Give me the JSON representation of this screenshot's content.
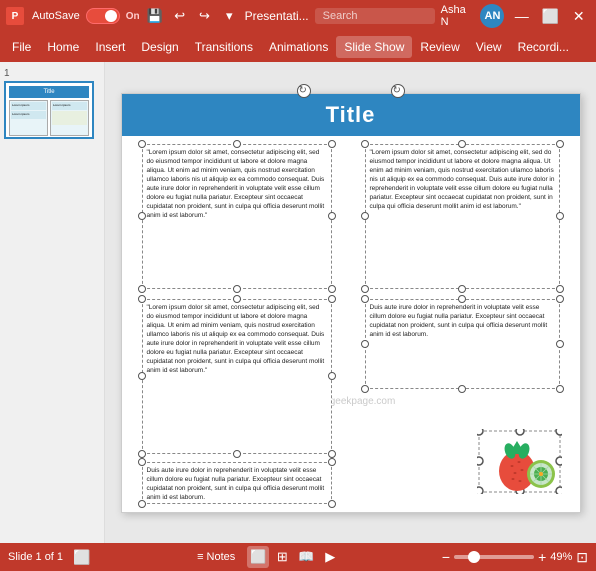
{
  "titleBar": {
    "appName": "P",
    "autosave": "AutoSave",
    "autosaveState": "On",
    "fileName": "Presentati...",
    "searchPlaceholder": "Search",
    "userName": "Asha N",
    "userInitials": "AN"
  },
  "menuBar": {
    "items": [
      "File",
      "Home",
      "Insert",
      "Design",
      "Transitions",
      "Animations",
      "Slide Show",
      "Review",
      "View",
      "Recordi..."
    ]
  },
  "slide": {
    "title": "Title",
    "watermark": "@thegeekpage.com",
    "textBox1": "\"Lorem ipsum dolor sit amet, consectetur adipiscing elit, sed do eiusmod tempor incididunt ut labore et dolore magna aliqua. Ut enim ad minim veniam, quis nostrud exercitation ullamco laboris nis ut aliquip ex ea commodo consequat. Duis aute irure dolor in reprehenderit in voluptate velit esse cillum dolore eu fugiat nulla pariatur. Excepteur sint occaecat cupidatat non proident, sunt in culpa qui officia deserunt mollit anim id est laborum.\"",
    "textBox2": "\"Lorem ipsum dolor sit amet, consectetur adipiscing elit, sed do eiusmod tempor incididunt ut labore et dolore magna aliqua. Ut enim ad minim veniam, quis nostrud exercitation ullamco laboris nis ut aliquip ex ea commodo consequat. Duis aute irure dolor in reprehenderit in voluptate velit esse cillum dolore eu fugiat nulla pariatur. Excepteur sint occaecat cupidatat non proident, sunt in culpa qui officia deserunt mollit anim id est laborum.\"",
    "textBox3": "\"Lorem ipsum dolor sit amet, consectetur adipiscing elit, sed do eiusmod tempor incididunt ut labore et dolore magna aliqua. Ut enim ad minim veniam, quis nostrud exercitation ullamco laboris nis ut aliquip ex ea commodo consequat. Duis aute irure dolor in reprehenderit in voluptate velit esse cillum dolore eu fugiat nulla pariatur. Excepteur sint occaecat cupidatat non proident, sunt in culpa qui officia deserunt mollit anim id est laborum.\"",
    "textBox4": "Duis aute irure dolor in reprehenderit in voluptate velit esse cillum dolore eu fugiat nulla pariatur. Excepteur sint occaecat cupidatat non proident, sunt in culpa qui officia deserunt mollit anim id est laborum.",
    "textBox5": "Duis aute irure dolor in reprehenderit in voluptate velit esse cillum dolore eu fugiat nulla pariatur. Excepteur sint occaecat cupidatat non proident, sunt in culpa qui officia deserunt mollit anim id est laborum."
  },
  "statusBar": {
    "slideCount": "Slide 1 of 1",
    "notes": "Notes",
    "zoom": "49%"
  },
  "thumbnail": {
    "slideNumber": "1"
  }
}
